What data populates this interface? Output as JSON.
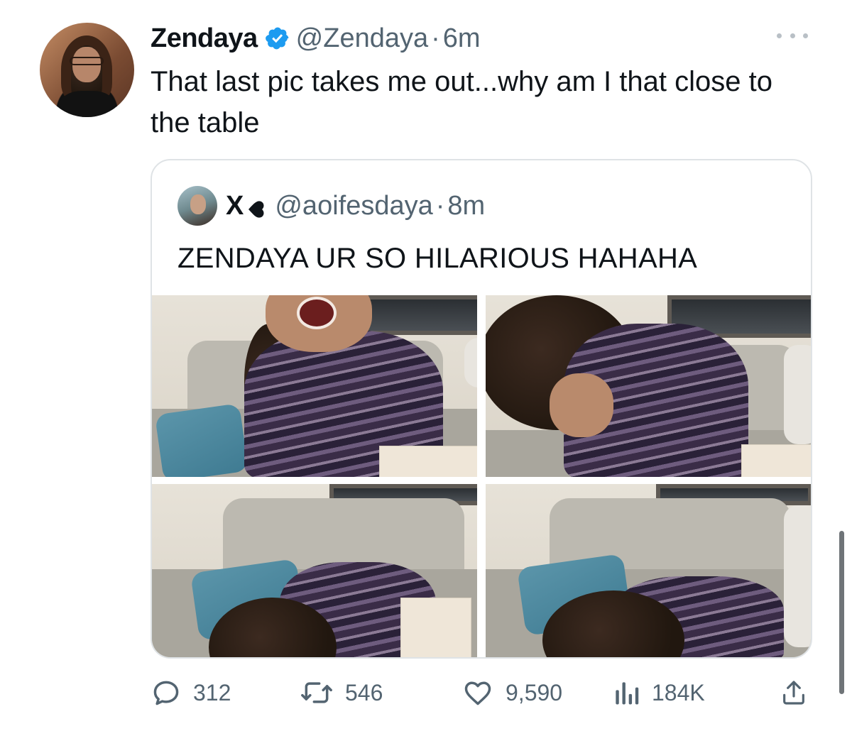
{
  "tweet": {
    "author_name": "Zendaya",
    "author_handle": "@Zendaya",
    "separator": "·",
    "time": "6m",
    "text": "That last pic takes me out...why am I that close to the table"
  },
  "quote": {
    "author_name": "X",
    "author_handle": "@aoifesdaya",
    "separator": "·",
    "time": "8m",
    "text": "ZENDAYA UR SO HILARIOUS HAHAHA"
  },
  "actions": {
    "replies": "312",
    "reposts": "546",
    "likes": "9,590",
    "views": "184K"
  },
  "icons": {
    "verified": "verified-badge-icon",
    "more": "more-icon",
    "reply": "reply-icon",
    "repost": "repost-icon",
    "like": "heart-icon",
    "views": "views-icon",
    "share": "share-icon"
  },
  "colors": {
    "verified": "#1d9bf0",
    "text": "#0f1419",
    "muted": "#536471",
    "border": "#dfe3e6"
  }
}
